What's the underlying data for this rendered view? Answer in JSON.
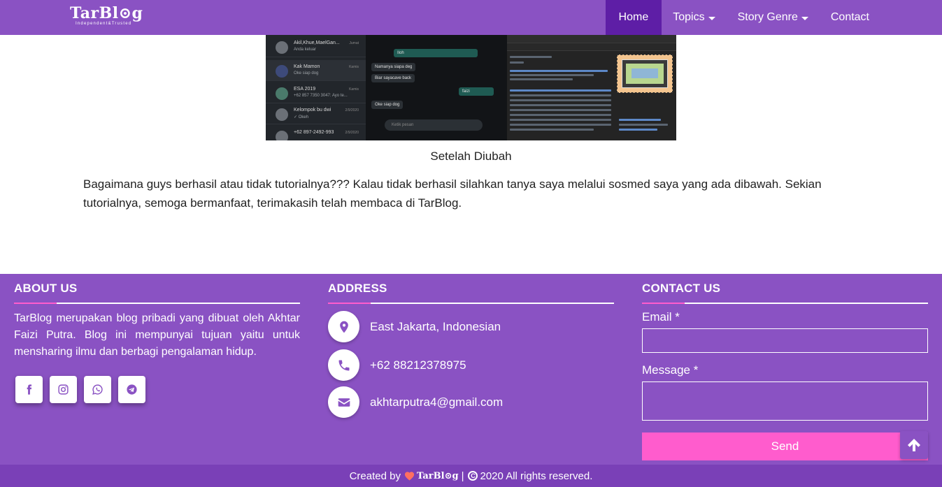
{
  "brand": {
    "name": "TarBlog",
    "logo_text": "TarBl⊙g",
    "tagline": "Independent&Trusted"
  },
  "nav": {
    "home": "Home",
    "topics": "Topics",
    "story_genre": "Story Genre",
    "contact": "Contact"
  },
  "article": {
    "screenshot": {
      "chats": [
        {
          "name": "Akil,Khue,MaelGan...",
          "sub": "Anda keluar",
          "time": "Jumat"
        },
        {
          "name": "Kak Mamon",
          "sub": "Oke siap dog",
          "time": "Kamis"
        },
        {
          "name": "ESA 2019",
          "sub": "+62 857 7350 3047: Ayo te...",
          "time": "Kamis"
        },
        {
          "name": "Kelompok bu dwi",
          "sub": "✓ Okeh",
          "time": "2/9/2020"
        },
        {
          "name": "+62 897-2492-993",
          "sub": "",
          "time": "2/9/2020"
        }
      ],
      "messages": {
        "m1": "Namanya siapa deg",
        "m2": "Iloh",
        "m3": "Biar sayacave back",
        "m4": "faizi",
        "m5": "Oke siap dog"
      },
      "input_placeholder": "Ketik pesan"
    },
    "caption": "Setelah Diubah",
    "paragraph": "Bagaimana guys berhasil atau tidak tutorialnya??? Kalau tidak berhasil silahkan tanya saya melalui sosmed saya yang ada dibawah. Sekian tutorialnya, semoga bermanfaat, terimakasih telah membaca di TarBlog."
  },
  "footer": {
    "about": {
      "title": "ABOUT US",
      "text": "TarBlog merupakan blog pribadi yang dibuat oleh Akhtar Faizi Putra. Blog ini mempunyai tujuan yaitu untuk mensharing ilmu dan berbagi pengalaman hidup.",
      "socials": [
        "facebook-icon",
        "instagram-icon",
        "whatsapp-icon",
        "telegram-icon"
      ]
    },
    "address": {
      "title": "ADDRESS",
      "location": "East Jakarta, Indonesian",
      "phone": "+62 88212378975",
      "email": "akhtarputra4@gmail.com"
    },
    "contact": {
      "title": "CONTACT US",
      "email_label": "Email *",
      "message_label": "Message *",
      "email_value": "",
      "message_value": "",
      "send_label": "Send"
    }
  },
  "bottom_bar": {
    "created_by": "Created by",
    "brand": "TarBl⊙g",
    "sep": "|",
    "copy_symbol": "C",
    "rights": "2020 All rights reserved."
  },
  "colors": {
    "primary": "#8a52c3",
    "nav_active": "#5e1ea6",
    "accent_pink": "#ff5ccd",
    "bottom_bar": "#7a40b7",
    "heart": "#ff6f61"
  }
}
